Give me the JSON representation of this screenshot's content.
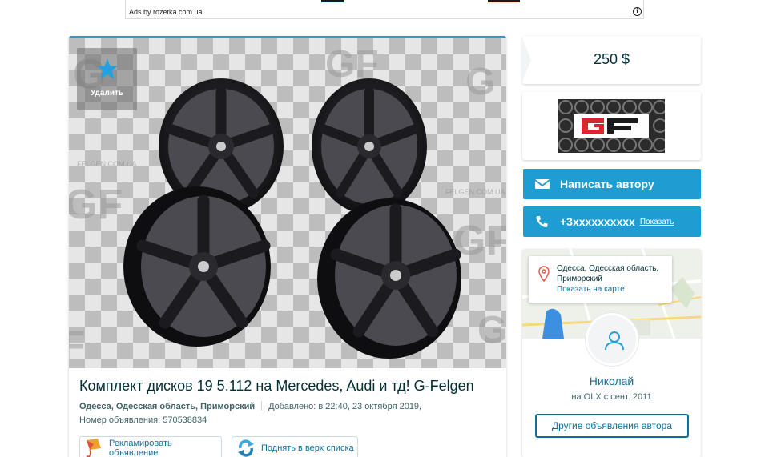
{
  "ad_banner": {
    "label": "Ads by rozetka.com.ua",
    "info_icon": "info-icon"
  },
  "listing": {
    "favorite_label": "Удалить",
    "favorite_icon": "star-icon",
    "photo_watermark": "G-FELGEN.COM.UA",
    "title": "Комплект дисков 19 5.112 на Mercedes, Audi и тд! G-Felgen",
    "location": "Одесса, Одесская область, Приморский",
    "added": "Добавлено: в 22:40, 23 октября 2019,",
    "ad_number": "Номер объявления: 570538834",
    "promote_label": "Рекламировать объявление",
    "promote_icon": "kite-icon",
    "bump_label": "Поднять в верх списка",
    "bump_icon": "refresh-arrows-icon"
  },
  "sidebar": {
    "price": "250 $",
    "seller_logo_text": "GF",
    "write_button": "Написать автору",
    "write_icon": "envelope-icon",
    "phone_number": "+3xxxxxxxxxx",
    "phone_show": "Показать",
    "phone_icon": "phone-icon",
    "address": "Одесса, Одесская область, Приморский",
    "show_on_map": "Показать на карте",
    "pin_icon": "map-pin-icon",
    "user_icon": "user-icon",
    "user_name": "Николай",
    "member_since": "на OLX с сент. 2011",
    "other_ads_button": "Другие объявления автора"
  },
  "colors": {
    "accent_blue": "#1e9dd2",
    "link_blue": "#0c6f9e",
    "text_dark": "#002f34",
    "logo_red": "#d9262b"
  }
}
